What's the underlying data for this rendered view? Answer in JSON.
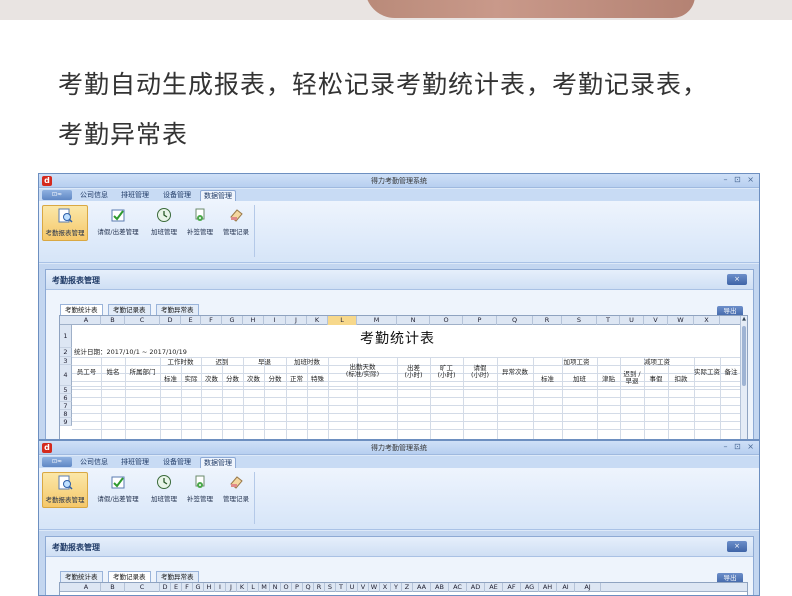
{
  "headline": {
    "line1": "考勤自动生成报表，轻松记录考勤统计表，考勤记录表，",
    "line2": "考勤异常表"
  },
  "window": {
    "title": "得力考勤管理系统",
    "controls": "– ⊡ ×",
    "logo": "d",
    "app_menu": "⊡≈"
  },
  "ribbon": {
    "tabs": [
      "公司信息",
      "排班管理",
      "设备管理",
      "数据管理"
    ],
    "active_tab": "数据管理",
    "buttons": [
      "考勤报表管理",
      "请假/出差管理",
      "加班管理",
      "补签管理",
      "管理记录"
    ]
  },
  "panel": {
    "title": "考勤报表管理",
    "close": "×",
    "export": "导出"
  },
  "sub_tabs": [
    "考勤统计表",
    "考勤记录表",
    "考勤异常表"
  ],
  "sheet1": {
    "columns": [
      "A",
      "B",
      "C",
      "D",
      "E",
      "F",
      "G",
      "H",
      "I",
      "J",
      "K",
      "L",
      "M",
      "N",
      "O",
      "P",
      "Q",
      "R",
      "S",
      "T",
      "U",
      "V",
      "W",
      "X"
    ],
    "selected_column": "L",
    "rows": [
      "1",
      "2",
      "3",
      "4",
      "5",
      "6",
      "7",
      "8",
      "9"
    ],
    "title": "考勤统计表",
    "date_line": "统计日期：2017/10/1 ~ 2017/10/19",
    "headers": {
      "emp_no": "员工号",
      "name": "姓名",
      "dept": "所属部门",
      "work_time": "工作时数",
      "standard": "标准",
      "actual": "实际",
      "late": "迟到",
      "times": "次数",
      "minutes": "分数",
      "early": "早退",
      "ot_hours": "加班时数",
      "normal": "正常",
      "special": "特殊",
      "attend_days": "出勤天数\n(标准/实际)",
      "trip": "出差\n(小时)",
      "absent": "旷工\n(小时)",
      "leave": "请假\n(小时)",
      "abnormal": "异常次数",
      "add_pay": "加项工资",
      "overtime": "加班",
      "allowance": "津贴",
      "deduct_pay": "减项工资",
      "late_early": "迟到 /\n早退",
      "personal_leave": "事假",
      "fine": "扣款",
      "real_pay": "实际工资",
      "remark": "备注"
    }
  },
  "sheet2": {
    "columns": [
      "A",
      "B",
      "C",
      "D",
      "E",
      "F",
      "G",
      "H",
      "I",
      "J",
      "K",
      "L",
      "M",
      "N",
      "O",
      "P",
      "Q",
      "R",
      "S",
      "T",
      "U",
      "V",
      "W",
      "X",
      "Y",
      "Z",
      "AA",
      "AB",
      "AC",
      "AD",
      "AE",
      "AF",
      "AG",
      "AH",
      "AI",
      "AJ"
    ]
  }
}
